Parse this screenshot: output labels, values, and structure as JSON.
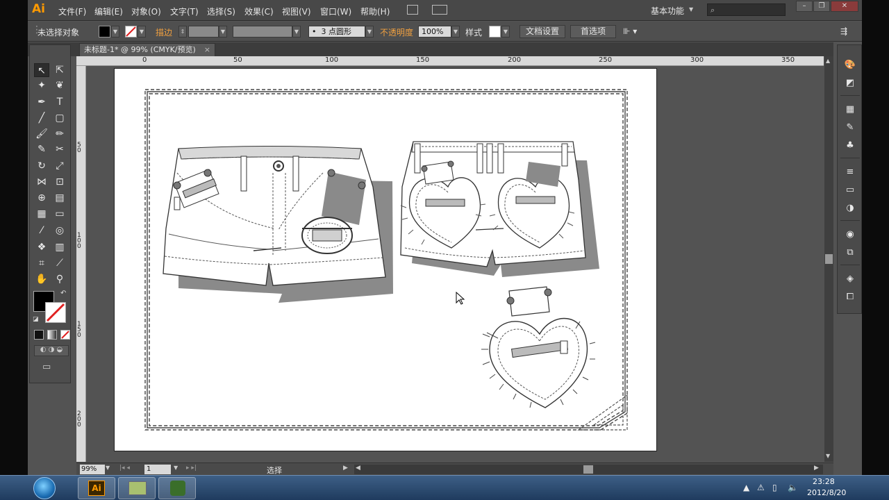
{
  "app": {
    "logo": "Ai",
    "menus": [
      "文件(F)",
      "编辑(E)",
      "对象(O)",
      "文字(T)",
      "选择(S)",
      "效果(C)",
      "视图(V)",
      "窗口(W)",
      "帮助(H)"
    ],
    "workspace": "基本功能",
    "accent": "#ff9a00"
  },
  "control": {
    "no_selection": "未选择对象",
    "stroke_label": "描边",
    "brush": "3 点圆形",
    "opacity_label": "不透明度",
    "opacity_value": "100%",
    "style_label": "样式",
    "doc_setup": "文档设置",
    "preferences": "首选项"
  },
  "tab": {
    "title": "未标题-1* @ 99% (CMYK/预览)",
    "close": "×"
  },
  "ruler": {
    "top": [
      "0",
      "50",
      "100",
      "150",
      "200",
      "250",
      "300",
      "350"
    ],
    "left": [
      "50",
      "100",
      "150",
      "200"
    ]
  },
  "status": {
    "zoom": "99%",
    "page": "1",
    "mode": "选择"
  },
  "taskbar": {
    "time": "23:28",
    "date": "2012/8/20"
  }
}
